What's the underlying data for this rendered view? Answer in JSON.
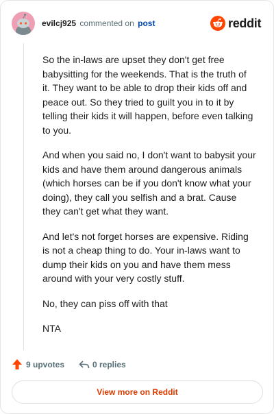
{
  "header": {
    "username": "evilcj925",
    "commented_on": "commented on",
    "post_link": "post",
    "brand": "reddit"
  },
  "comment": {
    "paragraphs": [
      "So the in-laws are upset they don't get free babysitting for the weekends. That is the truth of it. They want to be able to drop their kids off and peace out. So they tried to guilt you in to it by telling their kids it will happen, before even talking to you.",
      "And when you said no, I don't want to babysit your kids and have them around dangerous animals (which horses can be if you don't know what your doing), they call you selfish and a brat. Cause they can't get what they want.",
      "And let's not forget horses are expensive. Riding is not a cheap thing to do. Your in-laws want to dump their kids on you and have them mess around with your very costly stuff.",
      "No, they can piss off with that",
      "NTA"
    ]
  },
  "actions": {
    "upvotes": "9 upvotes",
    "replies": "0 replies"
  },
  "footer": {
    "view_more": "View more on Reddit"
  },
  "colors": {
    "brand_orange": "#ff4500",
    "link_blue": "#0045ac",
    "muted_text": "#576f76",
    "view_more_text": "#d93a00",
    "avatar_bg": "#ef9fb4"
  },
  "icons": {
    "avatar": "snoo-avatar-icon",
    "logo": "reddit-logo-icon",
    "upvote": "upvote-arrow-icon",
    "reply": "reply-arrow-icon"
  }
}
